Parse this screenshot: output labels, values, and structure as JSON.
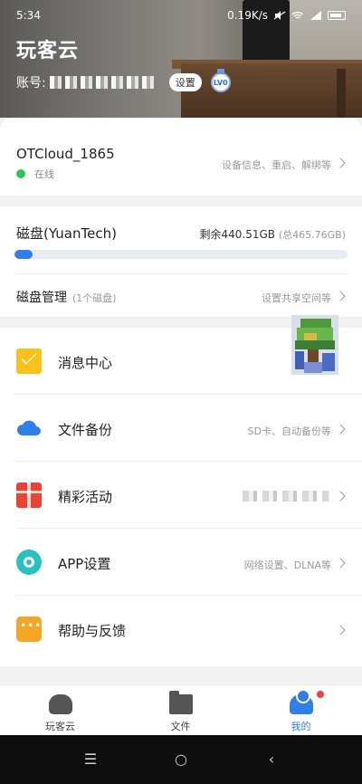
{
  "status_bar": {
    "time": "5:34",
    "network_speed": "0.19K/s"
  },
  "header": {
    "title": "玩客云",
    "account_label": "账号:",
    "settings_button": "设置",
    "level_badge": "LV0"
  },
  "device": {
    "name": "OTCloud_1865",
    "status": "在线",
    "status_color": "#2ec650",
    "hint": "设备信息、重启、解绑等"
  },
  "disk": {
    "title": "磁盘(YuanTech)",
    "free_text": "剩余440.51GB",
    "total_text": "(总465.76GB)",
    "used_fraction": 0.054,
    "manage_label": "磁盘管理",
    "manage_sub": "(1个磁盘)",
    "manage_hint": "设置共享空间等"
  },
  "menu": [
    {
      "label": "消息中心",
      "hint": "",
      "icon": "mail-icon"
    },
    {
      "label": "文件备份",
      "hint": "SD卡、自动备份等",
      "icon": "cloud-icon"
    },
    {
      "label": "精彩活动",
      "hint": "",
      "icon": "gift-icon"
    },
    {
      "label": "APP设置",
      "hint": "网络设置、DLNA等",
      "icon": "gear-icon"
    },
    {
      "label": "帮助与反馈",
      "hint": "",
      "icon": "chat-icon"
    }
  ],
  "tabs": [
    {
      "label": "玩客云",
      "active": false
    },
    {
      "label": "文件",
      "active": false
    },
    {
      "label": "我的",
      "active": true
    }
  ],
  "colors": {
    "accent": "#2f7fe8",
    "badge_red": "#f23b3b"
  }
}
